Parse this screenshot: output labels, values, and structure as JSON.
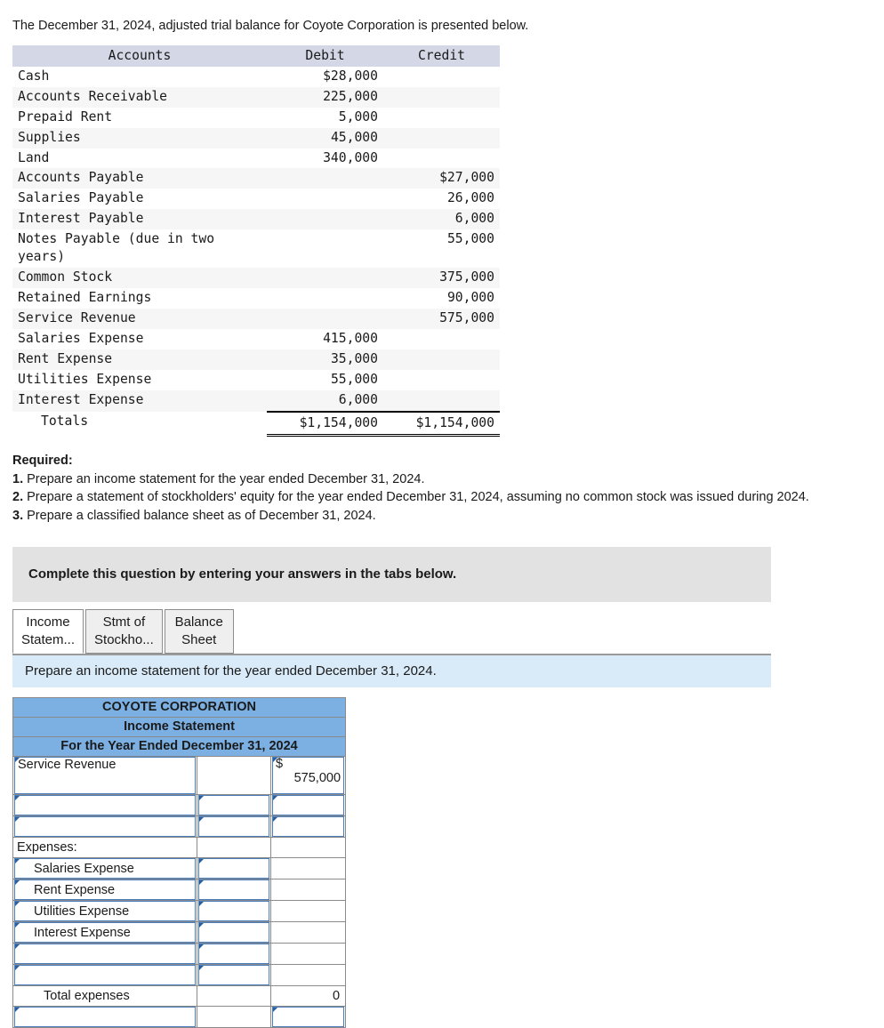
{
  "intro": "The December 31, 2024, adjusted trial balance for Coyote Corporation is presented below.",
  "trial_balance": {
    "headers": {
      "accounts": "Accounts",
      "debit": "Debit",
      "credit": "Credit"
    },
    "rows": [
      {
        "account": "Cash",
        "debit": "$28,000",
        "credit": ""
      },
      {
        "account": "Accounts Receivable",
        "debit": "225,000",
        "credit": ""
      },
      {
        "account": "Prepaid Rent",
        "debit": "5,000",
        "credit": ""
      },
      {
        "account": "Supplies",
        "debit": "45,000",
        "credit": ""
      },
      {
        "account": "Land",
        "debit": "340,000",
        "credit": ""
      },
      {
        "account": "Accounts Payable",
        "debit": "",
        "credit": "$27,000"
      },
      {
        "account": "Salaries Payable",
        "debit": "",
        "credit": "26,000"
      },
      {
        "account": "Interest Payable",
        "debit": "",
        "credit": "6,000"
      },
      {
        "account": "Notes Payable (due in two years)",
        "debit": "",
        "credit": "55,000"
      },
      {
        "account": "Common Stock",
        "debit": "",
        "credit": "375,000"
      },
      {
        "account": "Retained Earnings",
        "debit": "",
        "credit": "90,000"
      },
      {
        "account": "Service Revenue",
        "debit": "",
        "credit": "575,000"
      },
      {
        "account": "Salaries Expense",
        "debit": "415,000",
        "credit": ""
      },
      {
        "account": "Rent Expense",
        "debit": "35,000",
        "credit": ""
      },
      {
        "account": "Utilities Expense",
        "debit": "55,000",
        "credit": ""
      },
      {
        "account": "Interest Expense",
        "debit": "6,000",
        "credit": ""
      }
    ],
    "totals": {
      "label": "Totals",
      "debit": "$1,154,000",
      "credit": "$1,154,000"
    }
  },
  "required": {
    "heading": "Required:",
    "items": [
      {
        "num": "1.",
        "text": "Prepare an income statement for the year ended December 31, 2024."
      },
      {
        "num": "2.",
        "text": "Prepare a statement of stockholders' equity for the year ended December 31, 2024, assuming no common stock was issued during 2024."
      },
      {
        "num": "3.",
        "text": "Prepare a classified balance sheet as of December 31, 2024."
      }
    ]
  },
  "banner": "Complete this question by entering your answers in the tabs below.",
  "tabs": [
    {
      "label": "Income\nStatem...",
      "active": true
    },
    {
      "label": "Stmt of\nStockho...",
      "active": false
    },
    {
      "label": "Balance\nSheet",
      "active": false
    }
  ],
  "instruction": "Prepare an income statement for the year ended December 31, 2024.",
  "income_statement": {
    "title_lines": [
      "COYOTE CORPORATION",
      "Income Statement",
      "For the Year Ended December 31, 2024"
    ],
    "rows": [
      {
        "label": "Service Revenue",
        "c1_input": true,
        "c2_input": false,
        "c3_input": true,
        "c3_dollar": "$",
        "c3_value": "575,000",
        "tall": true
      },
      {
        "label": "",
        "c1_input": true,
        "c2_input": true,
        "c3_input": true
      },
      {
        "label": "",
        "c1_input": true,
        "c2_input": true,
        "c3_input": true
      },
      {
        "label": "Expenses:",
        "c1_input": false,
        "c2_input": false,
        "c3_input": false
      },
      {
        "label": "Salaries Expense",
        "c1_input": true,
        "c2_input": true,
        "c3_input": false,
        "indent": true
      },
      {
        "label": "Rent Expense",
        "c1_input": true,
        "c2_input": true,
        "c3_input": false,
        "indent": true
      },
      {
        "label": "Utilities Expense",
        "c1_input": true,
        "c2_input": true,
        "c3_input": false,
        "indent": true
      },
      {
        "label": "Interest Expense",
        "c1_input": true,
        "c2_input": true,
        "c3_input": false,
        "indent": true
      },
      {
        "label": "",
        "c1_input": true,
        "c2_input": true,
        "c3_input": false
      },
      {
        "label": "",
        "c1_input": true,
        "c2_input": true,
        "c3_input": false
      },
      {
        "label": "Total expenses",
        "c1_input": false,
        "c2_input": false,
        "c3_input": false,
        "c3_value": "0",
        "rule_top": true,
        "center": true
      },
      {
        "label": "",
        "c1_input": true,
        "c2_input": false,
        "c3_input": true,
        "rule_dbl": true
      }
    ]
  },
  "colors": {
    "header_blue": "#7cb0e3",
    "table_header_gray": "#d4d8e6",
    "banner_gray": "#e2e2e2",
    "instruction_blue": "#d9eaf8",
    "input_border": "#4a7ebb"
  }
}
